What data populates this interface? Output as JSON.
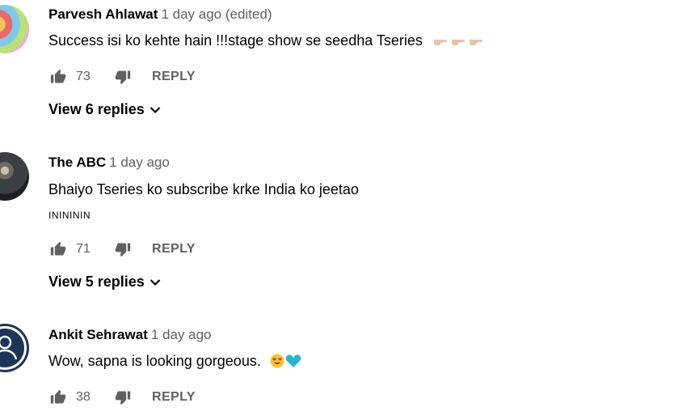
{
  "comments": [
    {
      "author": "Parvesh Ahlawat",
      "time": "1 day ago (edited)",
      "text": "Success isi ko kehte hain !!!stage show se seedha Tseries",
      "emoji": [
        "point-right-emoji",
        "point-right-emoji",
        "point-right-emoji"
      ],
      "likes": "73",
      "reply_label": "REPLY",
      "view_replies": "View 6 replies"
    },
    {
      "author": "The ABC",
      "time": "1 day ago",
      "text": "Bhaiyo Tseries ko subscribe krke India ko jeetao",
      "subtext": "ININININ",
      "likes": "71",
      "reply_label": "REPLY",
      "view_replies": "View 5 replies"
    },
    {
      "author": "Ankit Sehrawat",
      "time": "1 day ago",
      "text": "Wow, sapna is looking gorgeous.",
      "emoji": [
        "heart-eyes-emoji",
        "cyan-heart-emoji"
      ],
      "likes": "38",
      "reply_label": "REPLY"
    }
  ],
  "colors": {
    "text_primary": "#030303",
    "text_secondary": "#606060",
    "icon": "#606060",
    "cyan_heart": "#29b6c8"
  }
}
